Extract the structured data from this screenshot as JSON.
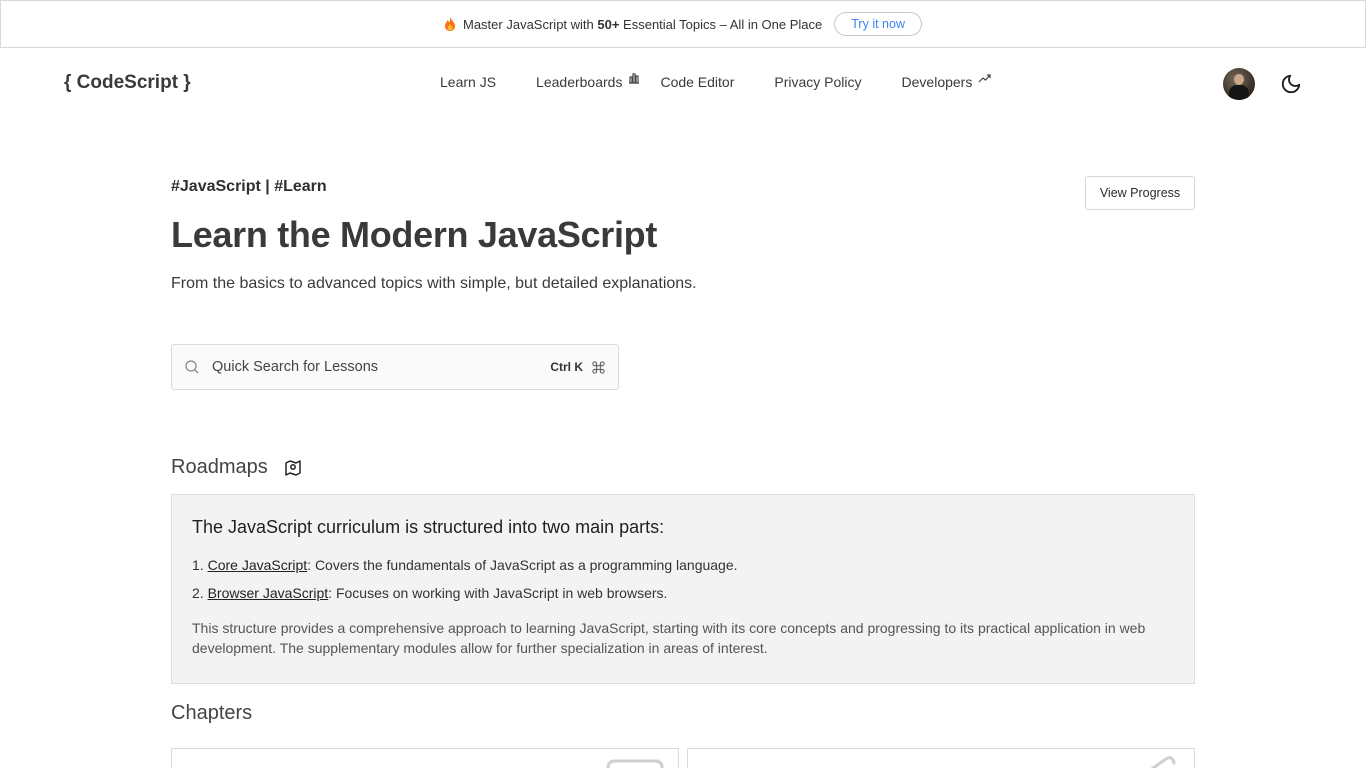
{
  "announcement": {
    "text_before": "Master JavaScript with ",
    "text_bold": "50+",
    "text_after": " Essential Topics – All in One Place",
    "cta_label": "Try it now",
    "icon": "flame-icon"
  },
  "header": {
    "logo": "{ CodeScript }",
    "nav": [
      {
        "label": "Learn JS"
      },
      {
        "label": "Leaderboards",
        "icon": "bar-chart-icon"
      },
      {
        "label": "Code Editor"
      },
      {
        "label": "Privacy Policy"
      },
      {
        "label": "Developers",
        "icon": "trending-up-icon"
      }
    ],
    "theme_toggle_icon": "moon-icon"
  },
  "hero": {
    "tags": "#JavaScript | #Learn",
    "title": "Learn the Modern JavaScript",
    "subtitle": "From the basics to advanced topics with simple, but detailed explanations.",
    "view_progress_label": "View Progress"
  },
  "search": {
    "placeholder": "Quick Search for Lessons",
    "shortcut": "Ctrl K"
  },
  "roadmaps": {
    "title": "Roadmaps",
    "heading": "The JavaScript curriculum is structured into two main parts:",
    "items": [
      {
        "number": "1. ",
        "link": "Core JavaScript",
        "desc": ": Covers the fundamentals of JavaScript as a programming language."
      },
      {
        "number": "2. ",
        "link": "Browser JavaScript",
        "desc": ": Focuses on working with JavaScript in web browsers."
      }
    ],
    "paragraph": "This structure provides a comprehensive approach to learning JavaScript, starting with its core concepts and progressing to its practical application in web development. The supplementary modules allow for further specialization in areas of interest."
  },
  "chapters": {
    "title": "Chapters"
  },
  "colors": {
    "accent_link": "#3b82f6",
    "flame": "#f97316",
    "box_bg": "#f3f3f3"
  }
}
